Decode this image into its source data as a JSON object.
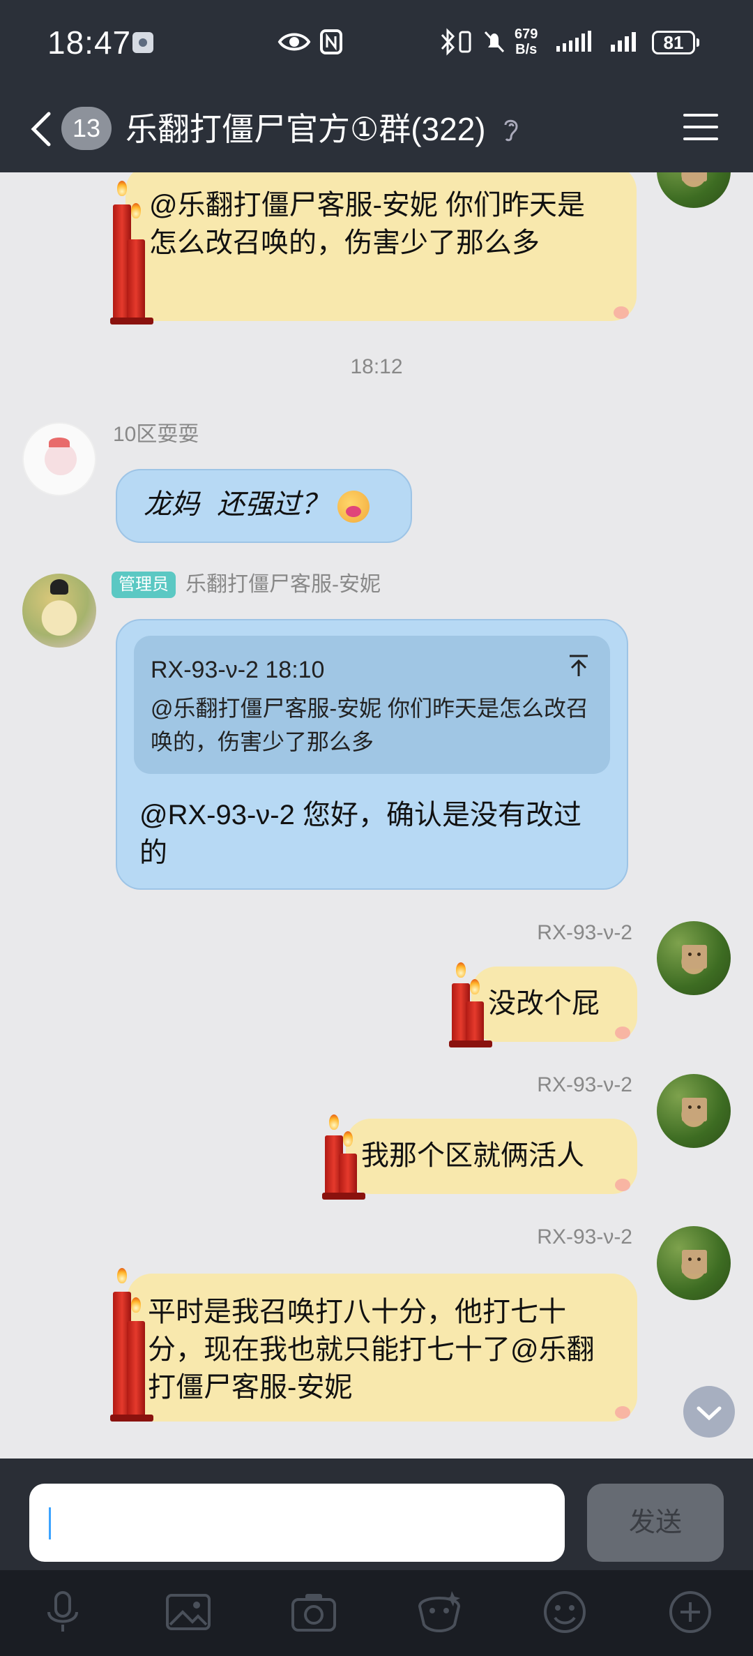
{
  "status_bar": {
    "time": "18:47",
    "net_speed_top": "679",
    "net_speed_bottom": "B/s",
    "battery": "81",
    "icons": [
      "eye-icon",
      "nfc-icon",
      "bluetooth-icon",
      "vibrate-icon",
      "mute-bell-icon",
      "signal-icon",
      "signal-icon",
      "battery-icon"
    ]
  },
  "header": {
    "back_icon": "chevron-left-icon",
    "unread_count": "13",
    "title": "乐翻打僵尸官方①群(322)",
    "ear_icon": "ear-icon",
    "menu_icon": "hamburger-menu-icon"
  },
  "messages": [
    {
      "id": "m0",
      "side": "right",
      "text": "@乐翻打僵尸客服-安妮 你们昨天是怎么改召唤的，伤害少了那么多"
    },
    {
      "id": "ts",
      "timestamp": "18:12"
    },
    {
      "id": "m1",
      "side": "left",
      "sender": "10区耍耍",
      "text": "龙妈  还强过？"
    },
    {
      "id": "m2",
      "side": "left",
      "badge": "管理员",
      "sender": "乐翻打僵尸客服-安妮",
      "quote": {
        "header": "RX-93-ν-2 18:10",
        "text": "@乐翻打僵尸客服-安妮 你们昨天是怎么改召唤的，伤害少了那么多"
      },
      "text": "@RX-93-ν-2 您好，确认是没有改过的"
    },
    {
      "id": "m3",
      "side": "right",
      "sender": "RX-93-ν-2",
      "text": "没改个屁"
    },
    {
      "id": "m4",
      "side": "right",
      "sender": "RX-93-ν-2",
      "text": "我那个区就俩活人"
    },
    {
      "id": "m5",
      "side": "right",
      "sender": "RX-93-ν-2",
      "text": "平时是我召唤打八十分，他打七十分，现在我也就只能打七十了@乐翻打僵尸客服-安妮"
    }
  ],
  "input_bar": {
    "placeholder": "",
    "send_label": "发送"
  },
  "toolbar": [
    "microphone-icon",
    "image-icon",
    "camera-icon",
    "sticker-icon",
    "emoji-icon",
    "plus-icon"
  ]
}
